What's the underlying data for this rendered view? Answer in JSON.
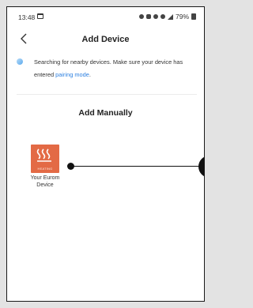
{
  "status_bar": {
    "time": "13:48",
    "battery": "79%"
  },
  "header": {
    "title": "Add Device",
    "back_icon": "chevron-left-icon"
  },
  "searching": {
    "text_before_link": "Searching for nearby devices. Make sure your device has entered ",
    "link_text": "pairing mode",
    "text_after_link": "."
  },
  "manual": {
    "title": "Add Manually"
  },
  "device": {
    "icon_caption": "HEATING",
    "name": "Your Eurom Device",
    "icon_color": "#e36a45"
  },
  "colors": {
    "link": "#2b7fe0",
    "text": "#222222"
  }
}
